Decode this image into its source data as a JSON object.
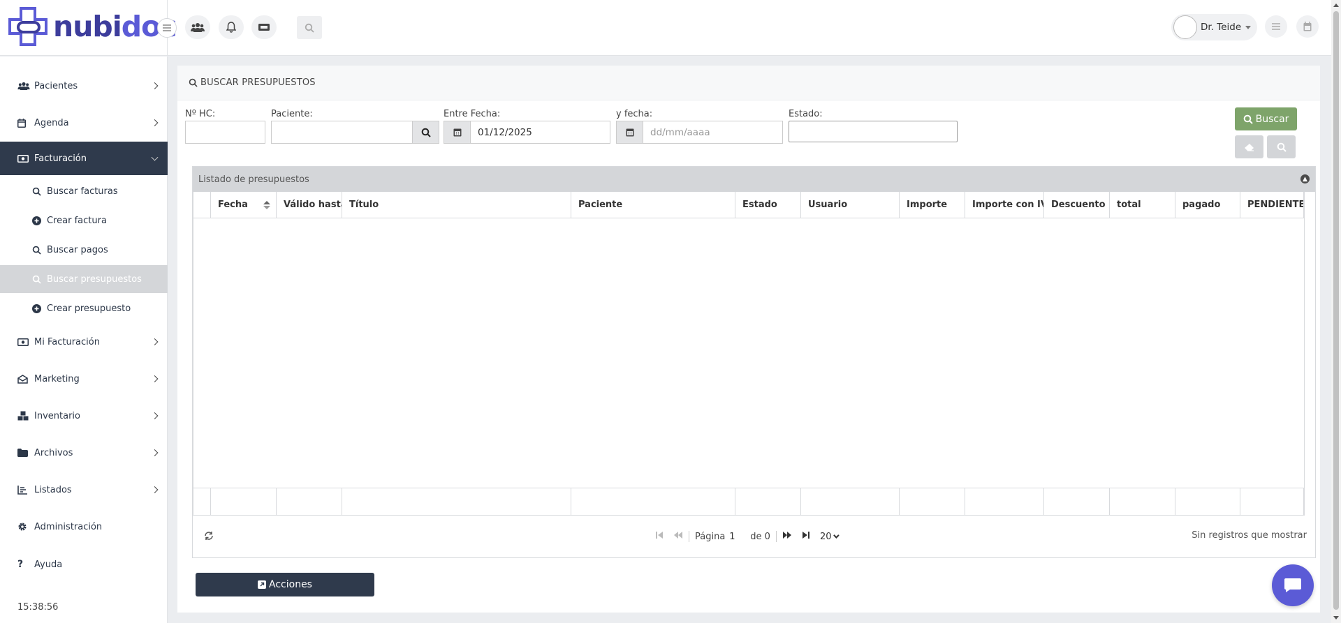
{
  "brand": {
    "name_part1": "nubi",
    "name_part2": "doc",
    "accent": "#5b5bd6"
  },
  "header": {
    "user_name": "Dr. Teide"
  },
  "sidebar": {
    "items": [
      {
        "label": "Pacientes",
        "icon": "users-icon"
      },
      {
        "label": "Agenda",
        "icon": "calendar-icon"
      },
      {
        "label": "Facturación",
        "icon": "money-icon",
        "active": true
      },
      {
        "label": "Mi Facturación",
        "icon": "money-icon"
      },
      {
        "label": "Marketing",
        "icon": "envelope-icon"
      },
      {
        "label": "Inventario",
        "icon": "boxes-icon"
      },
      {
        "label": "Archivos",
        "icon": "folder-icon"
      },
      {
        "label": "Listados",
        "icon": "chart-icon"
      },
      {
        "label": "Administración",
        "icon": "gear-icon"
      },
      {
        "label": "Ayuda",
        "icon": "question-icon"
      }
    ],
    "subitems": [
      {
        "label": "Buscar facturas",
        "icon": "search-icon"
      },
      {
        "label": "Crear factura",
        "icon": "plus-circle-icon"
      },
      {
        "label": "Buscar pagos",
        "icon": "search-icon"
      },
      {
        "label": "Buscar presupuestos",
        "icon": "search-icon",
        "selected": true
      },
      {
        "label": "Crear presupuesto",
        "icon": "plus-circle-icon"
      }
    ],
    "clock": "15:38:56"
  },
  "panel": {
    "title": "BUSCAR PRESUPUESTOS",
    "filters": {
      "hc_label": "Nº HC:",
      "hc_value": "",
      "patient_label": "Paciente:",
      "patient_value": "",
      "from_label": "Entre Fecha:",
      "from_value": "01/12/2025",
      "to_label": "y fecha:",
      "to_placeholder": "dd/mm/aaaa",
      "status_label": "Estado:",
      "status_value": ""
    },
    "search_button": "Buscar"
  },
  "grid": {
    "caption": "Listado de presupuestos",
    "columns": [
      "",
      "Fecha",
      "Válido hasta",
      "Título",
      "Paciente",
      "Estado",
      "Usuario",
      "Importe",
      "Importe con IVA",
      "Descuento",
      "total",
      "pagado",
      "PENDIENTE"
    ],
    "rows": [],
    "pager": {
      "page_label": "Página",
      "page_value": "1",
      "of_label": "de 0",
      "rows_per_page": "20",
      "records_text": "Sin registros que mostrar"
    }
  },
  "actions_button": "Acciones"
}
